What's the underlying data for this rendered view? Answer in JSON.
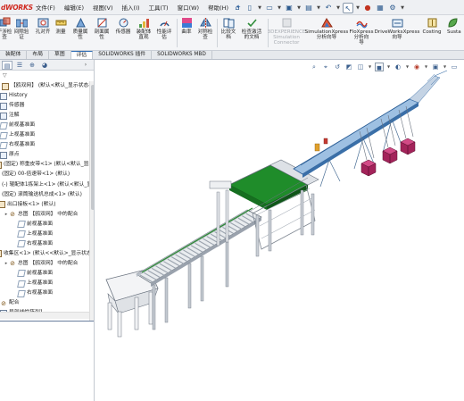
{
  "app": {
    "logo": "SOLIDWORKS",
    "logo_visible": "dWORKS"
  },
  "menu": [
    "文件(F)",
    "编辑(E)",
    "视图(V)",
    "插入(I)",
    "工具(T)",
    "窗口(W)",
    "帮助(H)"
  ],
  "quick_access_icons": [
    "home-icon",
    "new-doc-icon",
    "open-icon",
    "save-icon",
    "print-icon",
    "undo-icon",
    "select-icon",
    "rebuild-icon",
    "file-properties-icon",
    "options-icon"
  ],
  "ribbon": [
    {
      "label": "干涉检\n查",
      "icon": "interference-icon"
    },
    {
      "label": "间隙验\n证",
      "icon": "clearance-icon"
    },
    {
      "label": "孔对齐",
      "icon": "hole-align-icon"
    },
    {
      "label": "测量",
      "icon": "measure-icon"
    },
    {
      "label": "质量属\n性",
      "icon": "mass-properties-icon"
    },
    {
      "label": "剖面属\n性",
      "icon": "section-properties-icon"
    },
    {
      "label": "传感器",
      "icon": "sensor-icon"
    },
    {
      "label": "装配体\n直观",
      "icon": "assembly-visualization-icon"
    },
    {
      "label": "性能评\n估",
      "icon": "performance-icon"
    },
    {
      "label": "曲率",
      "icon": "curvature-icon"
    },
    {
      "label": "对称检\n查",
      "icon": "symmetry-icon"
    },
    {
      "label": "比较文\n档",
      "icon": "compare-icon"
    },
    {
      "label": "检查激活\n的文档",
      "icon": "check-active-icon"
    },
    {
      "label": "3DEXPERIENCE\nSimulation\nConnector",
      "icon": "3dx-icon",
      "disabled": true
    },
    {
      "label": "SimulationXpress\n分析向导",
      "icon": "simxpress-icon"
    },
    {
      "label": "FloXpress\n分析向\n导",
      "icon": "floxpress-icon"
    },
    {
      "label": "DriveWorksXpress\n向导",
      "icon": "driveworks-icon"
    },
    {
      "label": "Costing",
      "icon": "costing-icon"
    },
    {
      "label": "Susta",
      "icon": "sustainability-icon"
    }
  ],
  "tabs": [
    "装配体",
    "布局",
    "草图",
    "评估",
    "SOLIDWORKS 插件",
    "SOLIDWORKS MBD"
  ],
  "active_tab": "评估",
  "tree": {
    "root": "【鸥双网】 (默认<默认_显示状态-1",
    "items": [
      {
        "text": "History",
        "type": "folder"
      },
      {
        "text": "传感器",
        "type": "folder"
      },
      {
        "text": "注解",
        "type": "folder"
      },
      {
        "text": "前视基准面",
        "type": "plane"
      },
      {
        "text": "上视基准面",
        "type": "plane"
      },
      {
        "text": "右视基准面",
        "type": "plane"
      },
      {
        "text": "原点",
        "type": "origin"
      },
      {
        "text": "(固定) 称重皮带<1> (默认<默认_显示状",
        "type": "comp"
      },
      {
        "text": "(固定) 00-倍速带<1> (默认)",
        "type": "comp"
      },
      {
        "text": "(-) 辊配体1拣架上<1> (默认<默认_显示",
        "type": "comp"
      },
      {
        "text": "(固定) 滚筒输送机总成<1> (默认)",
        "type": "comp"
      },
      {
        "text": "出口接板<1> (默认)",
        "type": "comp"
      },
      {
        "text": "总图    【鸥双网】 中的配合",
        "type": "mate"
      },
      {
        "text": "前视基准面",
        "type": "plane"
      },
      {
        "text": "上视基准面",
        "type": "plane"
      },
      {
        "text": "右视基准面",
        "type": "plane"
      },
      {
        "text": "收集区<1> (默认<<默认>_显示状态 1>",
        "type": "comp"
      },
      {
        "text": "总图    【鸥双网】 中的配合",
        "type": "mate"
      },
      {
        "text": "前视基准面",
        "type": "plane"
      },
      {
        "text": "上视基准面",
        "type": "plane"
      },
      {
        "text": "右视基准面",
        "type": "plane"
      },
      {
        "text": "配合",
        "type": "mate"
      },
      {
        "text": "局部线性阵列1",
        "type": "pattern"
      }
    ]
  },
  "headsup_icons": [
    "zoom-fit-icon",
    "zoom-area-icon",
    "previous-view-icon",
    "section-view-icon",
    "view-orientation-icon",
    "display-style-icon",
    "hide-show-icon",
    "edit-appearance-icon",
    "scenes-icon",
    "view-settings-icon"
  ],
  "colors": {
    "accent_blue": "#2f6db5",
    "frame_blue": "#3a6fa8",
    "conveyor_green": "#1f8c2a",
    "box_magenta": "#a3235a",
    "steel_grey": "#9aa2ad",
    "logo_red": "#d0281e"
  }
}
